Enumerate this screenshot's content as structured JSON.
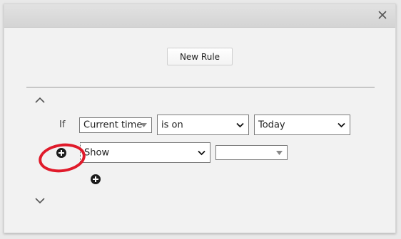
{
  "dialog": {
    "close_icon": "close-icon",
    "new_rule_label": "New Rule"
  },
  "rule": {
    "if_label": "If",
    "condition_field": "Current time",
    "operator": "is on",
    "value": "Today",
    "action": "Show",
    "target": ""
  },
  "icons": {
    "collapse": "chevron-up-icon",
    "expand": "chevron-down-icon",
    "add_action": "plus-circle-icon",
    "add_condition": "plus-circle-icon"
  },
  "annotation_color": "#e01a2a"
}
